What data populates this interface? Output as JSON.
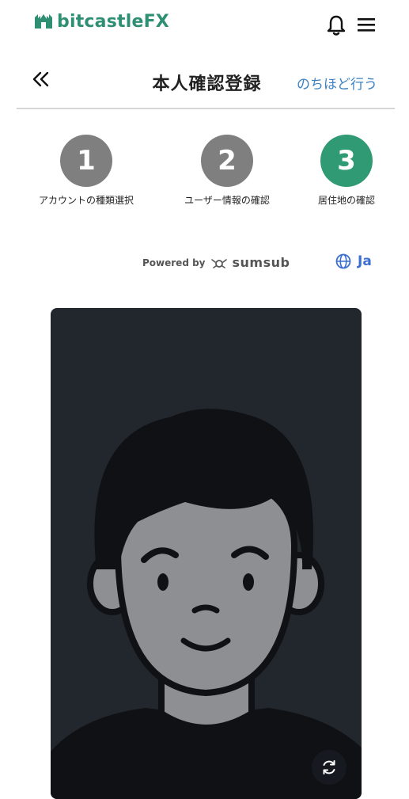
{
  "header": {
    "logo_prefix": "bitcastle",
    "logo_suffix": "FX",
    "icons": [
      "bell-icon",
      "hamburger-menu-icon"
    ]
  },
  "titlebar": {
    "back_icon": "double-chevron-left-icon",
    "title": "本人確認登録",
    "later_link": "のちほど行う"
  },
  "steps": [
    {
      "number": "1",
      "label": "アカウントの種類選択",
      "color": "#7f7f7f"
    },
    {
      "number": "2",
      "label": "ユーザー情報の確認",
      "color": "#7f7f7f"
    },
    {
      "number": "3",
      "label": "居住地の確認",
      "color": "#2f9a74"
    }
  ],
  "powered": {
    "prefix": "Powered by",
    "brand": "sumsub"
  },
  "language": {
    "icon": "globe-icon",
    "code": "Ja"
  },
  "camera": {
    "placeholder_icon": "person-avatar-illustration",
    "refresh_icon": "refresh-icon"
  },
  "colors": {
    "brand_green": "#2f9a74",
    "link_blue": "#3b82c4",
    "card_bg": "#22262d"
  }
}
